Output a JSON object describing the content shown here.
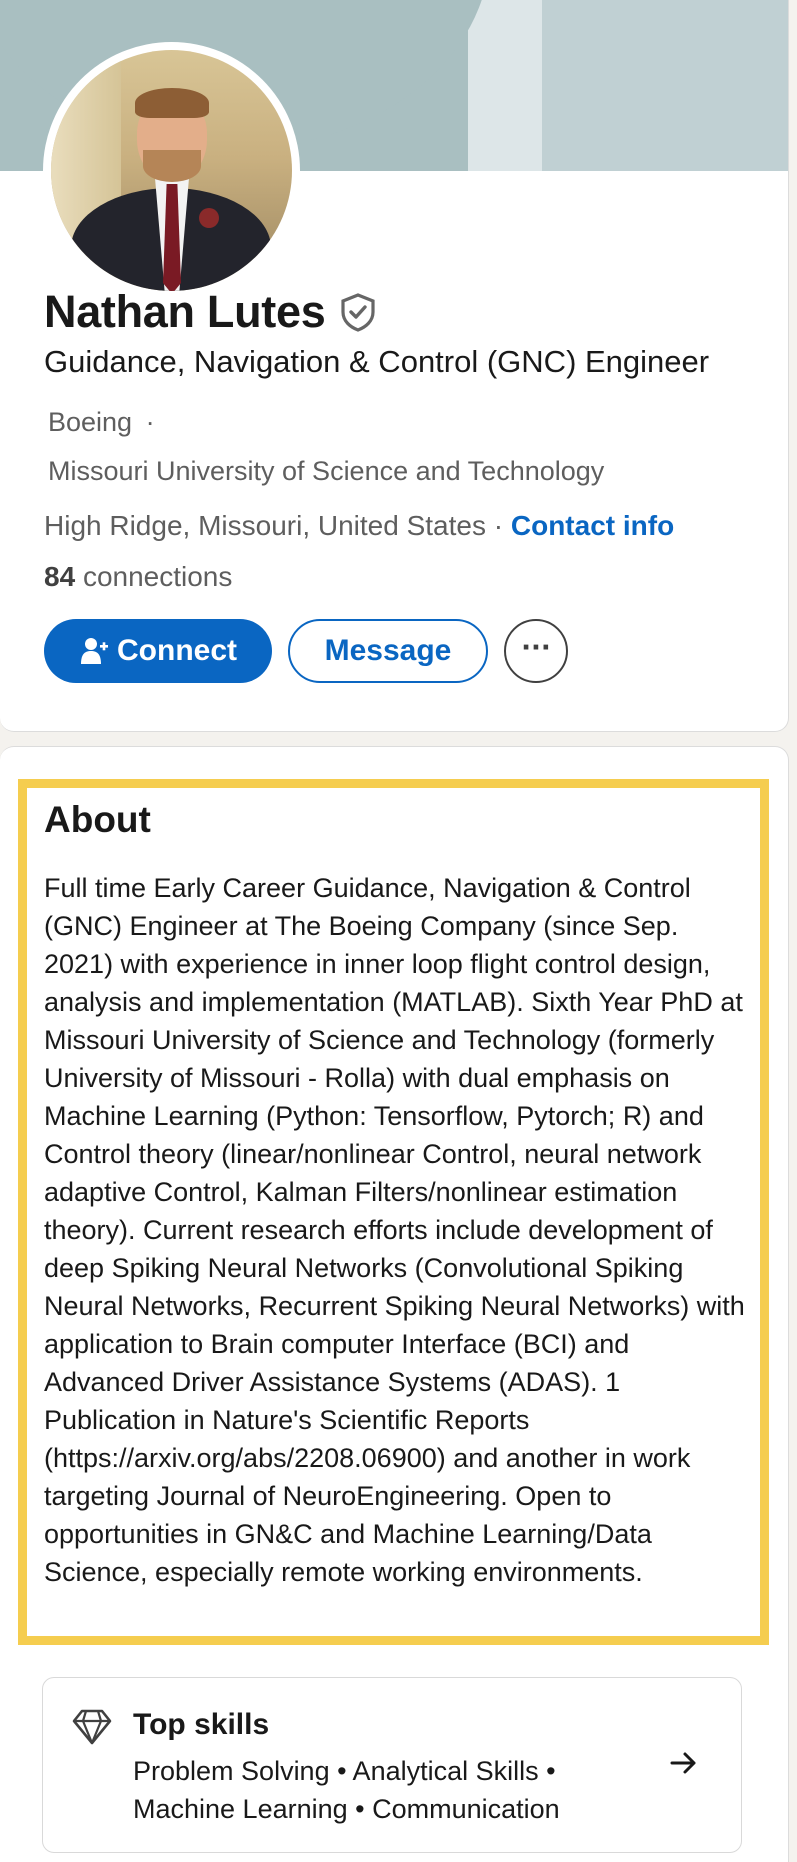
{
  "profile": {
    "name": "Nathan Lutes",
    "headline": "Guidance, Navigation & Control (GNC) Engineer",
    "company": "Boeing",
    "company_separator": "·",
    "school": "Missouri University of Science and Technology",
    "location": "High Ridge, Missouri, United States",
    "location_separator": "·",
    "contact_info_label": "Contact info",
    "connections_count": "84",
    "connections_label": "connections"
  },
  "actions": {
    "connect_label": "Connect",
    "message_label": "Message",
    "more_label": "···"
  },
  "about": {
    "title": "About",
    "text": "Full time Early Career Guidance, Navigation & Control (GNC) Engineer at The Boeing Company (since Sep. 2021) with experience in inner loop flight control design, analysis and implementation (MATLAB). Sixth Year PhD at Missouri University of Science and Technology (formerly University of Missouri - Rolla) with dual emphasis on Machine Learning (Python: Tensorflow, Pytorch; R) and Control theory (linear/nonlinear Control, neural network adaptive Control, Kalman Filters/nonlinear estimation theory). Current research efforts include development of deep Spiking Neural Networks (Convolutional Spiking Neural Networks, Recurrent Spiking Neural Networks) with application to Brain computer Interface (BCI) and Advanced Driver Assistance Systems (ADAS). 1 Publication in Nature's Scientific Reports (https://arxiv.org/abs/2208.06900) and another in work targeting Journal of NeuroEngineering. Open to opportunities in GN&C and Machine Learning/Data Science, especially remote working environments."
  },
  "top_skills": {
    "title": "Top skills",
    "line1": "Problem Solving • Analytical Skills •",
    "line2": "Machine Learning • Communication"
  },
  "colors": {
    "brand_blue": "#0a66c2",
    "highlight_yellow": "#f5cd4f",
    "banner": "#a9bfc1"
  },
  "icons": {
    "verified": "verified-shield-icon",
    "connect": "add-person-icon",
    "skills": "diamond-icon",
    "arrow": "arrow-right-icon"
  }
}
